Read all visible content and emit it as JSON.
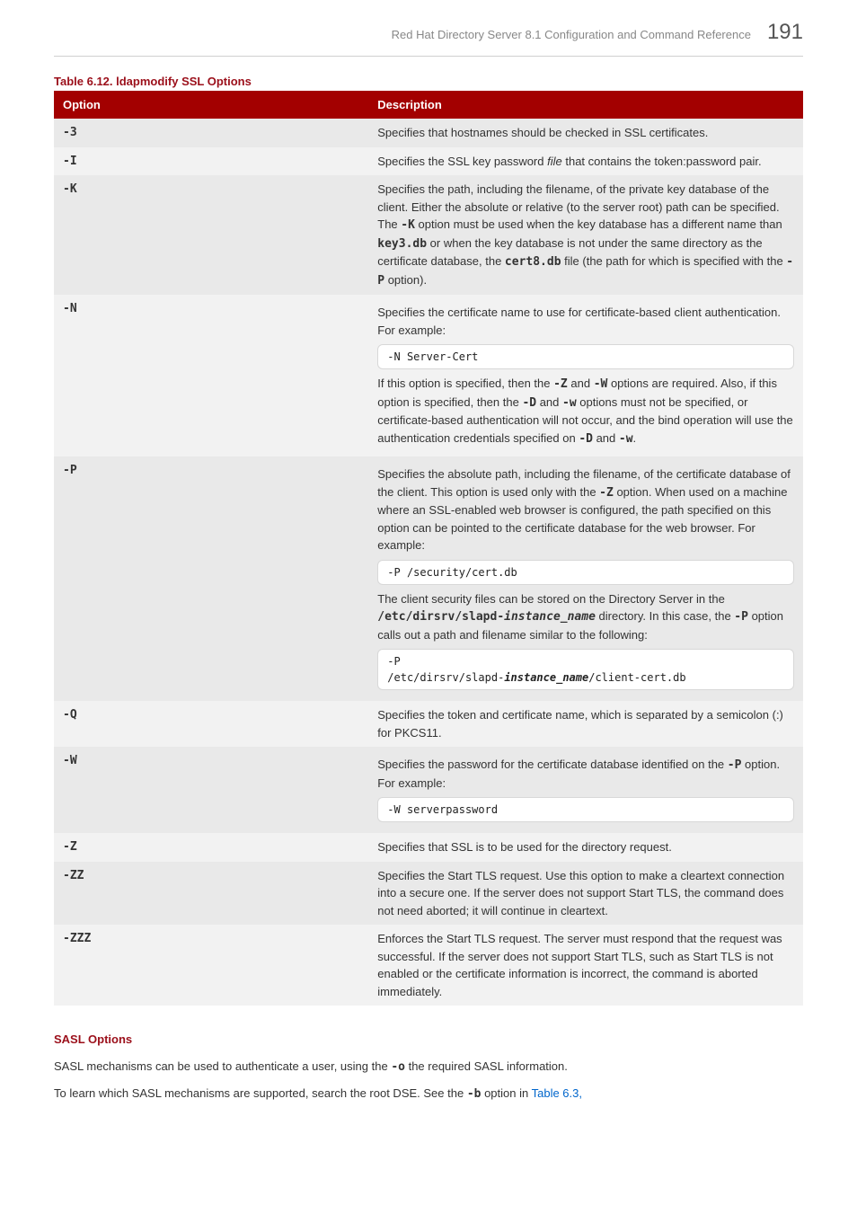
{
  "header": {
    "title": "Red Hat Directory Server 8.1 Configuration and Command Reference",
    "page_number": "191"
  },
  "table": {
    "caption": "Table 6.12. ldapmodify SSL Options",
    "col_option": "Option",
    "col_description": "Description",
    "rows": {
      "r_3": {
        "opt": "-3",
        "desc": "Specifies that hostnames should be checked in SSL certificates."
      },
      "r_I": {
        "opt": "-I",
        "desc_pre": "Specifies the SSL key password ",
        "desc_file": "file",
        "desc_post": " that contains the token:password pair."
      },
      "r_K": {
        "opt": "-K",
        "p1_a": "Specifies the path, including the filename, of the private key database of the client. Either the absolute or relative (to the server root) path can be specified. The ",
        "p1_b": "-K",
        "p1_c": " option must be used when the key database has a different name than ",
        "p1_d": "key3.db",
        "p1_e": " or when the key database is not under the same directory as the certificate database, the ",
        "p1_f": "cert8.db",
        "p1_g": " file (the path for which is specified with the ",
        "p1_h": "-P",
        "p1_i": " option)."
      },
      "r_N": {
        "opt": "-N",
        "p1": "Specifies the certificate name to use for certificate-based client authentication. For example:",
        "code1": "-N Server-Cert",
        "p2_a": "If this option is specified, then the ",
        "p2_b": "-Z",
        "p2_c": " and ",
        "p2_d": "-W",
        "p2_e": " options are required. Also, if this option is specified, then the ",
        "p2_f": "-D",
        "p2_g": " and ",
        "p2_h": "-w",
        "p2_i": " options must not be specified, or certificate-based authentication will not occur, and the bind operation will use the authentication credentials specified on ",
        "p2_j": "-D",
        "p2_k": " and ",
        "p2_l": "-w",
        "p2_m": "."
      },
      "r_P": {
        "opt": "-P",
        "p1_a": "Specifies the absolute path, including the filename, of the certificate database of the client. This option is used only with the ",
        "p1_b": "-Z",
        "p1_c": " option. When used on a machine where an SSL-enabled web browser is configured, the path specified on this option can be pointed to the certificate database for the web browser. For example:",
        "code1": "-P /security/cert.db",
        "p2_a": "The client security files can be stored on the Directory Server in the ",
        "p2_b": "/etc/dirsrv/slapd-",
        "p2_c": "instance_name",
        "p2_d": " directory. In this case, the ",
        "p2_e": "-P",
        "p2_f": " option calls out a path and filename similar to the following:",
        "code2_a": "-P\n/etc/dirsrv/slapd-",
        "code2_b": "instance_name",
        "code2_c": "/client-cert.db"
      },
      "r_Q": {
        "opt": "-Q",
        "desc": "Specifies the token and certificate name, which is separated by a semicolon (:) for PKCS11."
      },
      "r_W": {
        "opt": "-W",
        "p1_a": "Specifies the password for the certificate database identified on the ",
        "p1_b": "-P",
        "p1_c": " option. For example:",
        "code1": "-W serverpassword"
      },
      "r_Z": {
        "opt": "-Z",
        "desc": "Specifies that SSL is to be used for the directory request."
      },
      "r_ZZ": {
        "opt": "-ZZ",
        "desc": "Specifies the Start TLS request. Use this option to make a cleartext connection into a secure one. If the server does not support Start TLS, the command does not need aborted; it will continue in cleartext."
      },
      "r_ZZZ": {
        "opt": "-ZZZ",
        "desc": "Enforces the Start TLS request. The server must respond that the request was successful. If the server does not support Start TLS, such as Start TLS is not enabled or the certificate information is incorrect, the command is aborted immediately."
      }
    }
  },
  "sasl": {
    "heading": "SASL Options",
    "p1_a": "SASL mechanisms can be used to authenticate a user, using the ",
    "p1_b": "-o",
    "p1_c": " the required SASL information.",
    "p2_a": "To learn which SASL mechanisms are supported, search the root DSE. See the ",
    "p2_b": "-b",
    "p2_c": " option in ",
    "p2_link": "Table 6.3,"
  }
}
